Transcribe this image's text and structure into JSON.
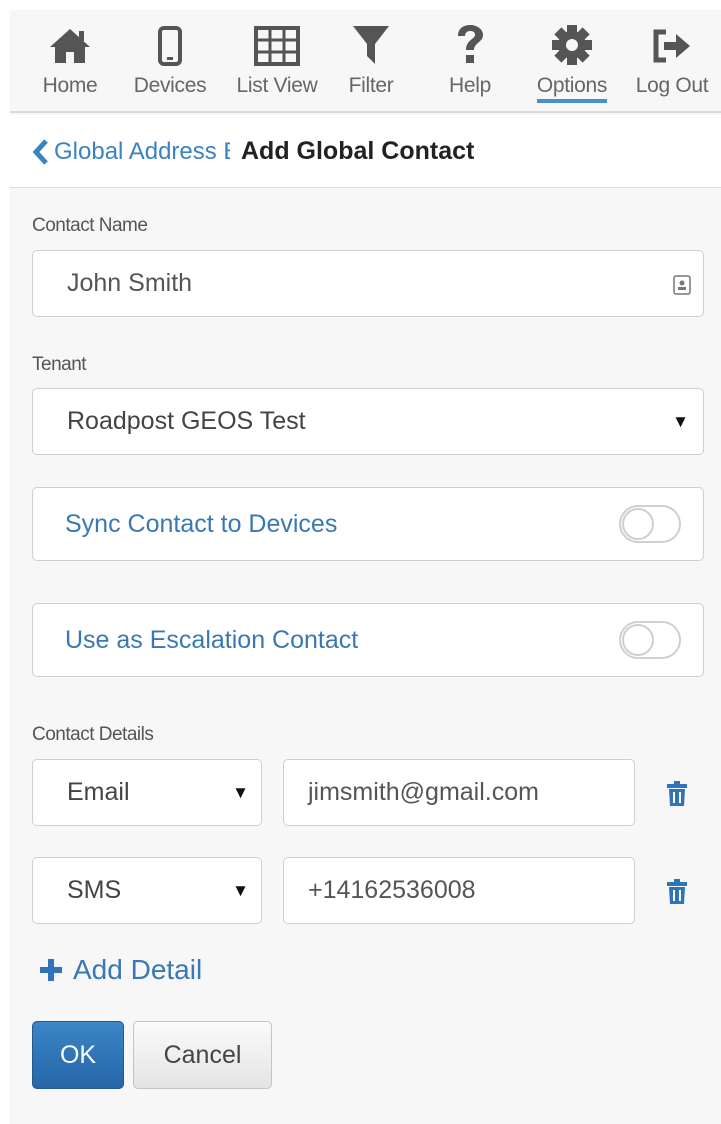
{
  "nav": {
    "items": [
      {
        "label": "Home",
        "icon": "home-icon"
      },
      {
        "label": "Devices",
        "icon": "phone-icon"
      },
      {
        "label": "List View",
        "icon": "table-icon"
      },
      {
        "label": "Filter",
        "icon": "filter-icon"
      },
      {
        "label": "Help",
        "icon": "question-icon"
      },
      {
        "label": "Options",
        "icon": "gear-icon",
        "active": true
      },
      {
        "label": "Log Out",
        "icon": "sign-out-icon"
      }
    ]
  },
  "header": {
    "back_label": "Global Address Book",
    "title": "Add Global Contact"
  },
  "form": {
    "contact_name_label": "Contact Name",
    "contact_name_value": "John Smith",
    "tenant_label": "Tenant",
    "tenant_value": "Roadpost GEOS Test",
    "sync_label": "Sync Contact to Devices",
    "sync_on": false,
    "escalation_label": "Use as Escalation Contact",
    "escalation_on": false,
    "details_label": "Contact Details",
    "details": [
      {
        "type": "Email",
        "value": "jimsmith@gmail.com"
      },
      {
        "type": "SMS",
        "value": "+14162536008"
      }
    ],
    "add_detail_label": "Add Detail"
  },
  "buttons": {
    "ok": "OK",
    "cancel": "Cancel"
  },
  "colors": {
    "accent": "#3a78b5",
    "primary_button": "#2a6fb0",
    "active_underline": "#4a90c8"
  }
}
